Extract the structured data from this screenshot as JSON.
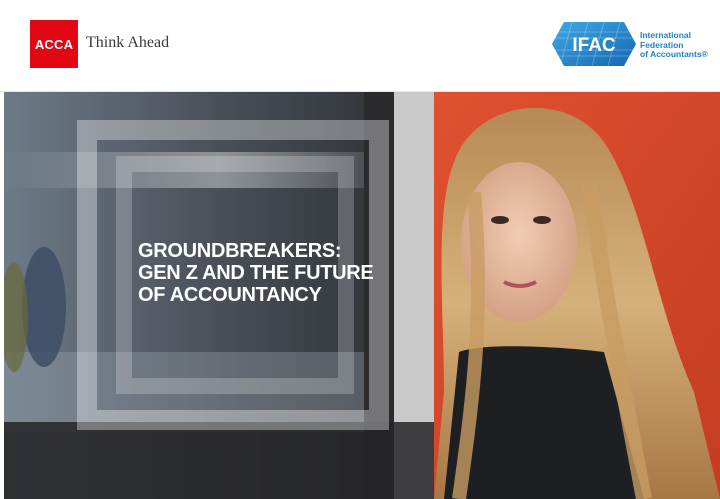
{
  "header": {
    "acca_logo_text": "ACCA",
    "acca_tagline": "Think Ahead",
    "ifac_logo_text": "IFAC",
    "ifac_name_lines": [
      "International",
      "Federation",
      "of Accountants®"
    ]
  },
  "cover": {
    "headline_lines": [
      "GROUNDBREAKERS:",
      "GEN Z AND THE FUTURE",
      "OF ACCOUNTANCY"
    ]
  },
  "colors": {
    "acca_red": "#e30613",
    "ifac_blue": "#1f7fc7",
    "hero_red_wall": "#d8462a"
  }
}
